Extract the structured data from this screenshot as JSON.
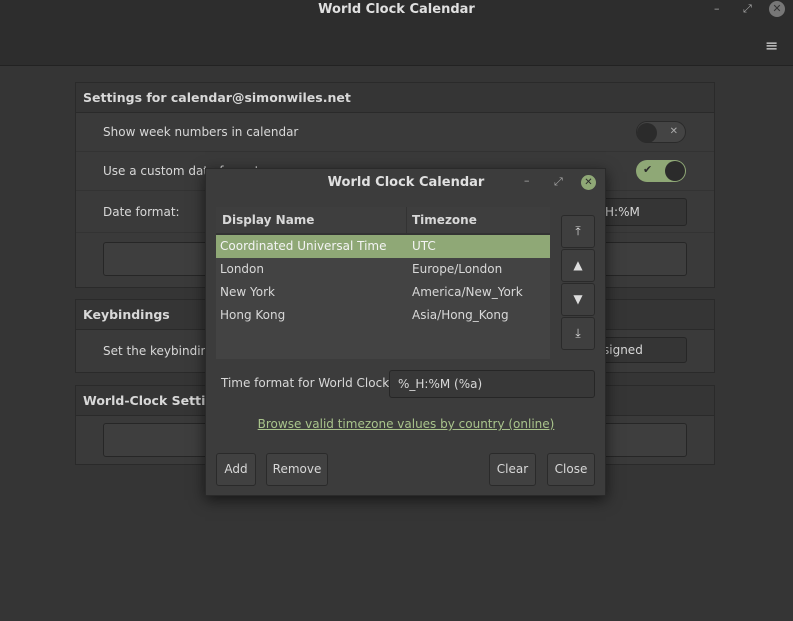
{
  "window": {
    "title": "World Clock Calendar",
    "menu_icon": "hamburger-icon"
  },
  "settings": {
    "section1_title": "Settings for calendar@simonwiles.net",
    "show_week_numbers": "Show week numbers in calendar",
    "show_week_numbers_on": false,
    "custom_date_format": "Use a custom date format",
    "custom_date_format_on": true,
    "date_format_label": "Date format:",
    "date_format_value": "H:%M",
    "section2_title": "Keybindings",
    "keybinding_label": "Set the keybinding",
    "keybinding_value": "signed",
    "section3_title": "World-Clock Settings"
  },
  "dialog": {
    "title": "World Clock Calendar",
    "columns": [
      "Display Name",
      "Timezone"
    ],
    "rows": [
      {
        "name": "Coordinated Universal Time",
        "tz": "UTC"
      },
      {
        "name": "London",
        "tz": "Europe/London"
      },
      {
        "name": "New York",
        "tz": "America/New_York"
      },
      {
        "name": "Hong Kong",
        "tz": "Asia/Hong_Kong"
      }
    ],
    "time_format_label": "Time format for World Clocks",
    "time_format_value": "%_H:%M (%a)",
    "link": "Browse valid timezone values by country (online)",
    "add": "Add",
    "remove": "Remove",
    "clear": "Clear",
    "close": "Close"
  },
  "colors": {
    "accent": "#8fa876"
  }
}
